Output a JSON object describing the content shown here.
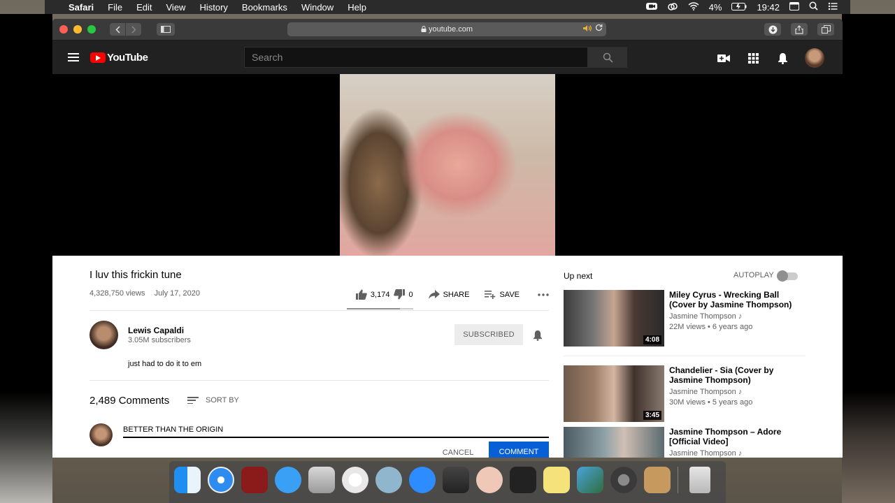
{
  "menubar": {
    "app": "Safari",
    "items": [
      "File",
      "Edit",
      "View",
      "History",
      "Bookmarks",
      "Window",
      "Help"
    ],
    "battery": "4%",
    "time": "19:42"
  },
  "browser": {
    "url": "youtube.com"
  },
  "youtube": {
    "logo_text": "YouTube",
    "search_placeholder": "Search"
  },
  "video": {
    "title": "I luv this frickin tune",
    "views": "4,328,750 views",
    "date": "July 17, 2020",
    "likes": "3,174",
    "dislikes": "0",
    "like_ratio": 0.8,
    "share_label": "SHARE",
    "save_label": "SAVE"
  },
  "channel": {
    "name": "Lewis Capaldi",
    "subscribers": "3.05M subscribers",
    "subscribe_label": "SUBSCRIBED"
  },
  "description": "just had to do it to em",
  "comments": {
    "count": "2,489 Comments",
    "sort_label": "SORT BY",
    "draft": "BETTER THAN THE ORIGIN",
    "cancel_label": "CANCEL",
    "comment_label": "COMMENT"
  },
  "sidebar": {
    "up_next": "Up next",
    "autoplay": "AUTOPLAY",
    "videos": [
      {
        "title": "Miley Cyrus - Wrecking Ball (Cover by Jasmine Thompson)",
        "channel": "Jasmine Thompson ♪",
        "meta": "22M views • 6 years ago",
        "duration": "4:08"
      },
      {
        "title": "Chandelier - Sia (Cover by Jasmine Thompson)",
        "channel": "Jasmine Thompson ♪",
        "meta": "30M views • 5 years ago",
        "duration": "3:45"
      },
      {
        "title": "Jasmine Thompson – Adore [Official Video]",
        "channel": "Jasmine Thompson ♪",
        "meta": "",
        "duration": ""
      }
    ]
  },
  "colors": {
    "yt_red": "#ff0000",
    "comment_blue": "#065fd4"
  }
}
